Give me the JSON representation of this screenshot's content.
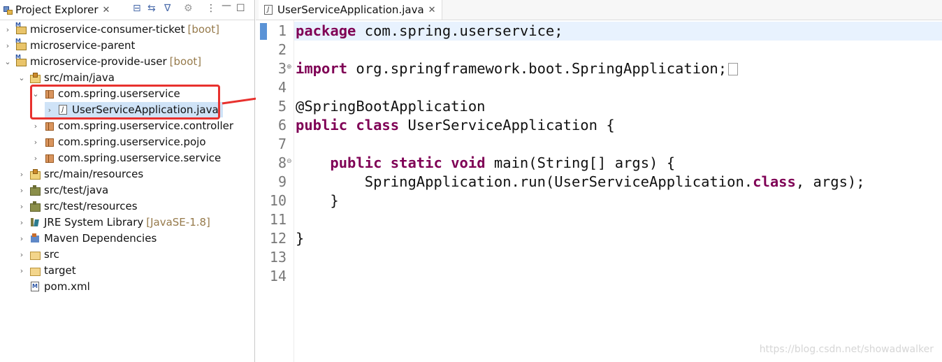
{
  "explorer": {
    "tab_label": "Project Explorer",
    "tab_close": "✕",
    "toolbar": {
      "collapse": "⊟",
      "link": "⇆",
      "filter": "∇",
      "settings": "⚙",
      "menu": "⋮",
      "minimize": "—",
      "maximize": "☐"
    },
    "items": [
      {
        "label": "microservice-consumer-ticket",
        "decoration": "[boot]",
        "twisty": "›"
      },
      {
        "label": "microservice-parent",
        "decoration": "",
        "twisty": "›"
      },
      {
        "label": "microservice-provide-user",
        "decoration": "[boot]",
        "twisty": "⌄"
      },
      {
        "label": "src/main/java",
        "decoration": "",
        "twisty": "⌄"
      },
      {
        "label": "com.spring.userservice",
        "decoration": "",
        "twisty": "⌄"
      },
      {
        "label": "UserServiceApplication.java",
        "decoration": "",
        "twisty": "›"
      },
      {
        "label": "com.spring.userservice.controller",
        "decoration": "",
        "twisty": "›"
      },
      {
        "label": "com.spring.userservice.pojo",
        "decoration": "",
        "twisty": "›"
      },
      {
        "label": "com.spring.userservice.service",
        "decoration": "",
        "twisty": "›"
      },
      {
        "label": "src/main/resources",
        "decoration": "",
        "twisty": "›"
      },
      {
        "label": "src/test/java",
        "decoration": "",
        "twisty": "›"
      },
      {
        "label": "src/test/resources",
        "decoration": "",
        "twisty": "›"
      },
      {
        "label": "JRE System Library",
        "decoration": "[JavaSE-1.8]",
        "twisty": "›"
      },
      {
        "label": "Maven Dependencies",
        "decoration": "",
        "twisty": "›"
      },
      {
        "label": "src",
        "decoration": "",
        "twisty": "›"
      },
      {
        "label": "target",
        "decoration": "",
        "twisty": "›"
      },
      {
        "label": "pom.xml",
        "decoration": "",
        "twisty": ""
      }
    ]
  },
  "editor": {
    "tab_label": "UserServiceApplication.java",
    "tab_close": "✕",
    "lines": [
      {
        "num": "1"
      },
      {
        "num": "2"
      },
      {
        "num": "3"
      },
      {
        "num": "4"
      },
      {
        "num": "5"
      },
      {
        "num": "6"
      },
      {
        "num": "7"
      },
      {
        "num": "8"
      },
      {
        "num": "9"
      },
      {
        "num": "10"
      },
      {
        "num": "11"
      },
      {
        "num": "12"
      },
      {
        "num": "13"
      },
      {
        "num": "14"
      }
    ],
    "code": {
      "l1_kw": "package",
      "l1_rest": " com.spring.userservice;",
      "l3_kw": "import",
      "l3_rest": " org.springframework.boot.SpringApplication;",
      "l6": "@SpringBootApplication",
      "l7_kw1": "public",
      "l7_kw2": "class",
      "l7_rest": " UserServiceApplication {",
      "l9_indent": "    ",
      "l9_kw1": "public",
      "l9_kw2": "static",
      "l9_kw3": "void",
      "l9_rest": " main(String[] args) {",
      "l10_a": "        SpringApplication.run(UserServiceApplication.",
      "l10_kw": "class",
      "l10_b": ", args);",
      "l11": "    }",
      "l13": "}"
    },
    "fold_collapsed": "⊕",
    "fold_expanded": "⊖"
  },
  "watermark": "https://blog.csdn.net/showadwalker",
  "colors": {
    "keyword": "#7f0055",
    "highlight_box": "#e8312e",
    "selection": "#cfe3f7",
    "current_line": "#e8f2fe"
  }
}
